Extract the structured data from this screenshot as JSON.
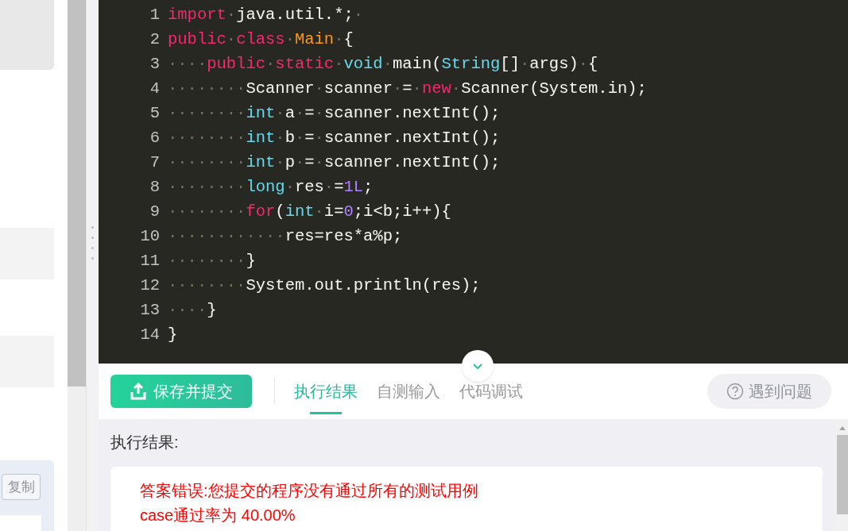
{
  "left_panel": {
    "copy_button": "复制"
  },
  "editor": {
    "lines": [
      {
        "number": "1",
        "tokens": [
          {
            "kind": "keyword",
            "text": "import"
          },
          {
            "kind": "ws",
            "text": "·"
          },
          {
            "kind": "plain",
            "text": "java.util.*;"
          },
          {
            "kind": "ws",
            "text": "·"
          }
        ]
      },
      {
        "number": "2",
        "tokens": [
          {
            "kind": "keyword",
            "text": "public"
          },
          {
            "kind": "ws",
            "text": "·"
          },
          {
            "kind": "keyword",
            "text": "class"
          },
          {
            "kind": "ws",
            "text": "·"
          },
          {
            "kind": "class",
            "text": "Main"
          },
          {
            "kind": "ws",
            "text": "·"
          },
          {
            "kind": "plain",
            "text": "{"
          }
        ]
      },
      {
        "number": "3",
        "tokens": [
          {
            "kind": "ws",
            "text": "····"
          },
          {
            "kind": "keyword",
            "text": "public"
          },
          {
            "kind": "ws",
            "text": "·"
          },
          {
            "kind": "keyword",
            "text": "static"
          },
          {
            "kind": "ws",
            "text": "·"
          },
          {
            "kind": "type",
            "text": "void"
          },
          {
            "kind": "ws",
            "text": "·"
          },
          {
            "kind": "plain",
            "text": "main("
          },
          {
            "kind": "type",
            "text": "String"
          },
          {
            "kind": "plain",
            "text": "[]"
          },
          {
            "kind": "ws",
            "text": "·"
          },
          {
            "kind": "plain",
            "text": "args)"
          },
          {
            "kind": "ws",
            "text": "·"
          },
          {
            "kind": "plain",
            "text": "{"
          }
        ]
      },
      {
        "number": "4",
        "tokens": [
          {
            "kind": "ws",
            "text": "········"
          },
          {
            "kind": "plain",
            "text": "Scanner"
          },
          {
            "kind": "ws",
            "text": "·"
          },
          {
            "kind": "plain",
            "text": "scanner"
          },
          {
            "kind": "ws",
            "text": "·"
          },
          {
            "kind": "plain",
            "text": "="
          },
          {
            "kind": "ws",
            "text": "·"
          },
          {
            "kind": "keyword",
            "text": "new"
          },
          {
            "kind": "ws",
            "text": "·"
          },
          {
            "kind": "plain",
            "text": "Scanner(System.in);"
          }
        ]
      },
      {
        "number": "5",
        "tokens": [
          {
            "kind": "ws",
            "text": "········"
          },
          {
            "kind": "type",
            "text": "int"
          },
          {
            "kind": "ws",
            "text": "·"
          },
          {
            "kind": "plain",
            "text": "a"
          },
          {
            "kind": "ws",
            "text": "·"
          },
          {
            "kind": "plain",
            "text": "="
          },
          {
            "kind": "ws",
            "text": "·"
          },
          {
            "kind": "plain",
            "text": "scanner.nextInt();"
          }
        ]
      },
      {
        "number": "6",
        "tokens": [
          {
            "kind": "ws",
            "text": "········"
          },
          {
            "kind": "type",
            "text": "int"
          },
          {
            "kind": "ws",
            "text": "·"
          },
          {
            "kind": "plain",
            "text": "b"
          },
          {
            "kind": "ws",
            "text": "·"
          },
          {
            "kind": "plain",
            "text": "="
          },
          {
            "kind": "ws",
            "text": "·"
          },
          {
            "kind": "plain",
            "text": "scanner.nextInt();"
          }
        ]
      },
      {
        "number": "7",
        "tokens": [
          {
            "kind": "ws",
            "text": "········"
          },
          {
            "kind": "type",
            "text": "int"
          },
          {
            "kind": "ws",
            "text": "·"
          },
          {
            "kind": "plain",
            "text": "p"
          },
          {
            "kind": "ws",
            "text": "·"
          },
          {
            "kind": "plain",
            "text": "="
          },
          {
            "kind": "ws",
            "text": "·"
          },
          {
            "kind": "plain",
            "text": "scanner.nextInt();"
          }
        ]
      },
      {
        "number": "8",
        "tokens": [
          {
            "kind": "ws",
            "text": "········"
          },
          {
            "kind": "type",
            "text": "long"
          },
          {
            "kind": "ws",
            "text": "·"
          },
          {
            "kind": "plain",
            "text": "res"
          },
          {
            "kind": "ws",
            "text": "·"
          },
          {
            "kind": "plain",
            "text": "="
          },
          {
            "kind": "number",
            "text": "1L"
          },
          {
            "kind": "plain",
            "text": ";"
          }
        ]
      },
      {
        "number": "9",
        "tokens": [
          {
            "kind": "ws",
            "text": "········"
          },
          {
            "kind": "keyword",
            "text": "for"
          },
          {
            "kind": "plain",
            "text": "("
          },
          {
            "kind": "type",
            "text": "int"
          },
          {
            "kind": "ws",
            "text": "·"
          },
          {
            "kind": "plain",
            "text": "i="
          },
          {
            "kind": "number",
            "text": "0"
          },
          {
            "kind": "plain",
            "text": ";i<b;i++){"
          }
        ]
      },
      {
        "number": "10",
        "tokens": [
          {
            "kind": "ws",
            "text": "············"
          },
          {
            "kind": "plain",
            "text": "res=res*a%p;"
          }
        ]
      },
      {
        "number": "11",
        "tokens": [
          {
            "kind": "ws",
            "text": "········"
          },
          {
            "kind": "plain",
            "text": "}"
          }
        ]
      },
      {
        "number": "12",
        "tokens": [
          {
            "kind": "ws",
            "text": "········"
          },
          {
            "kind": "plain",
            "text": "System.out.println(res);"
          }
        ]
      },
      {
        "number": "13",
        "tokens": [
          {
            "kind": "ws",
            "text": "····"
          },
          {
            "kind": "plain",
            "text": "}"
          }
        ]
      },
      {
        "number": "14",
        "tokens": [
          {
            "kind": "plain",
            "text": "}"
          }
        ]
      }
    ]
  },
  "toolbar": {
    "submit_button": "保存并提交",
    "tabs": [
      {
        "label": "执行结果",
        "selected": true
      },
      {
        "label": "自测输入",
        "selected": false
      },
      {
        "label": "代码调试",
        "selected": false
      }
    ],
    "help_button": "遇到问题"
  },
  "results": {
    "heading": "执行结果:",
    "messages": [
      "答案错误:您提交的程序没有通过所有的测试用例",
      "case通过率为 40.00%"
    ]
  }
}
